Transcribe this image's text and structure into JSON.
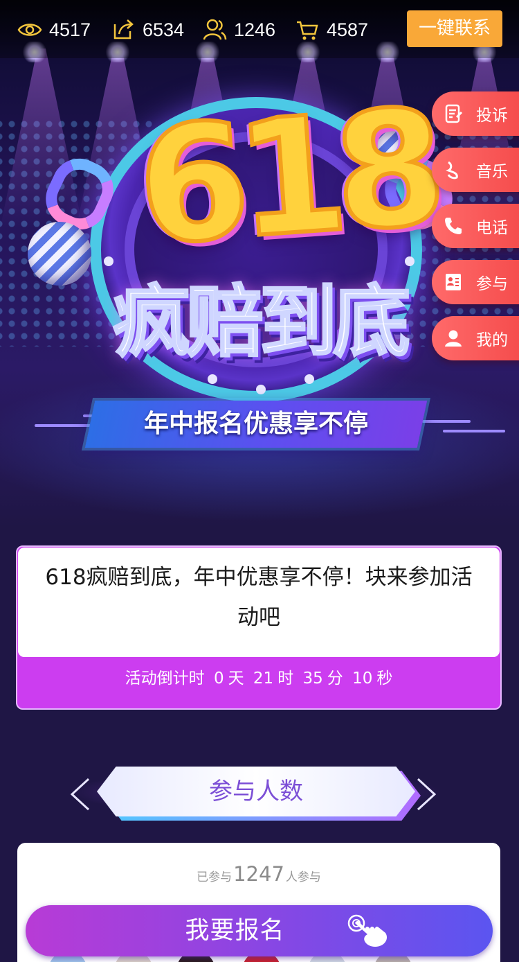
{
  "stats": {
    "views": "4517",
    "shares": "6534",
    "users": "1246",
    "orders": "4587"
  },
  "contact_button": "一键联系",
  "side_menu": [
    {
      "label": "投诉",
      "icon": "complaint-icon"
    },
    {
      "label": "音乐",
      "icon": "music-icon"
    },
    {
      "label": "电话",
      "icon": "phone-icon"
    },
    {
      "label": "参与",
      "icon": "participate-icon"
    },
    {
      "label": "我的",
      "icon": "user-icon"
    }
  ],
  "hero": {
    "number": "618",
    "title": "疯赔到底",
    "banner": "年中报名优惠享不停"
  },
  "info": {
    "text": "618疯赔到底，年中优惠享不停！块来参加活动吧",
    "countdown_label": "活动倒计时",
    "days": "0",
    "days_unit": "天",
    "hours": "21",
    "hours_unit": "时",
    "minutes": "35",
    "minutes_unit": "分",
    "seconds": "10",
    "seconds_unit": "秒"
  },
  "participants": {
    "section_title": "参与人数",
    "prefix": "已参与",
    "count": "1247",
    "suffix": "人参与"
  },
  "signup_button": "我要报名",
  "colors": {
    "accent_orange": "#f9a838",
    "side_red": "#f44a4a",
    "card_purple": "#cc3df0",
    "button_gradient_start": "#b83bd6",
    "button_gradient_end": "#5b55f0",
    "page_bg": "#1f1645"
  }
}
